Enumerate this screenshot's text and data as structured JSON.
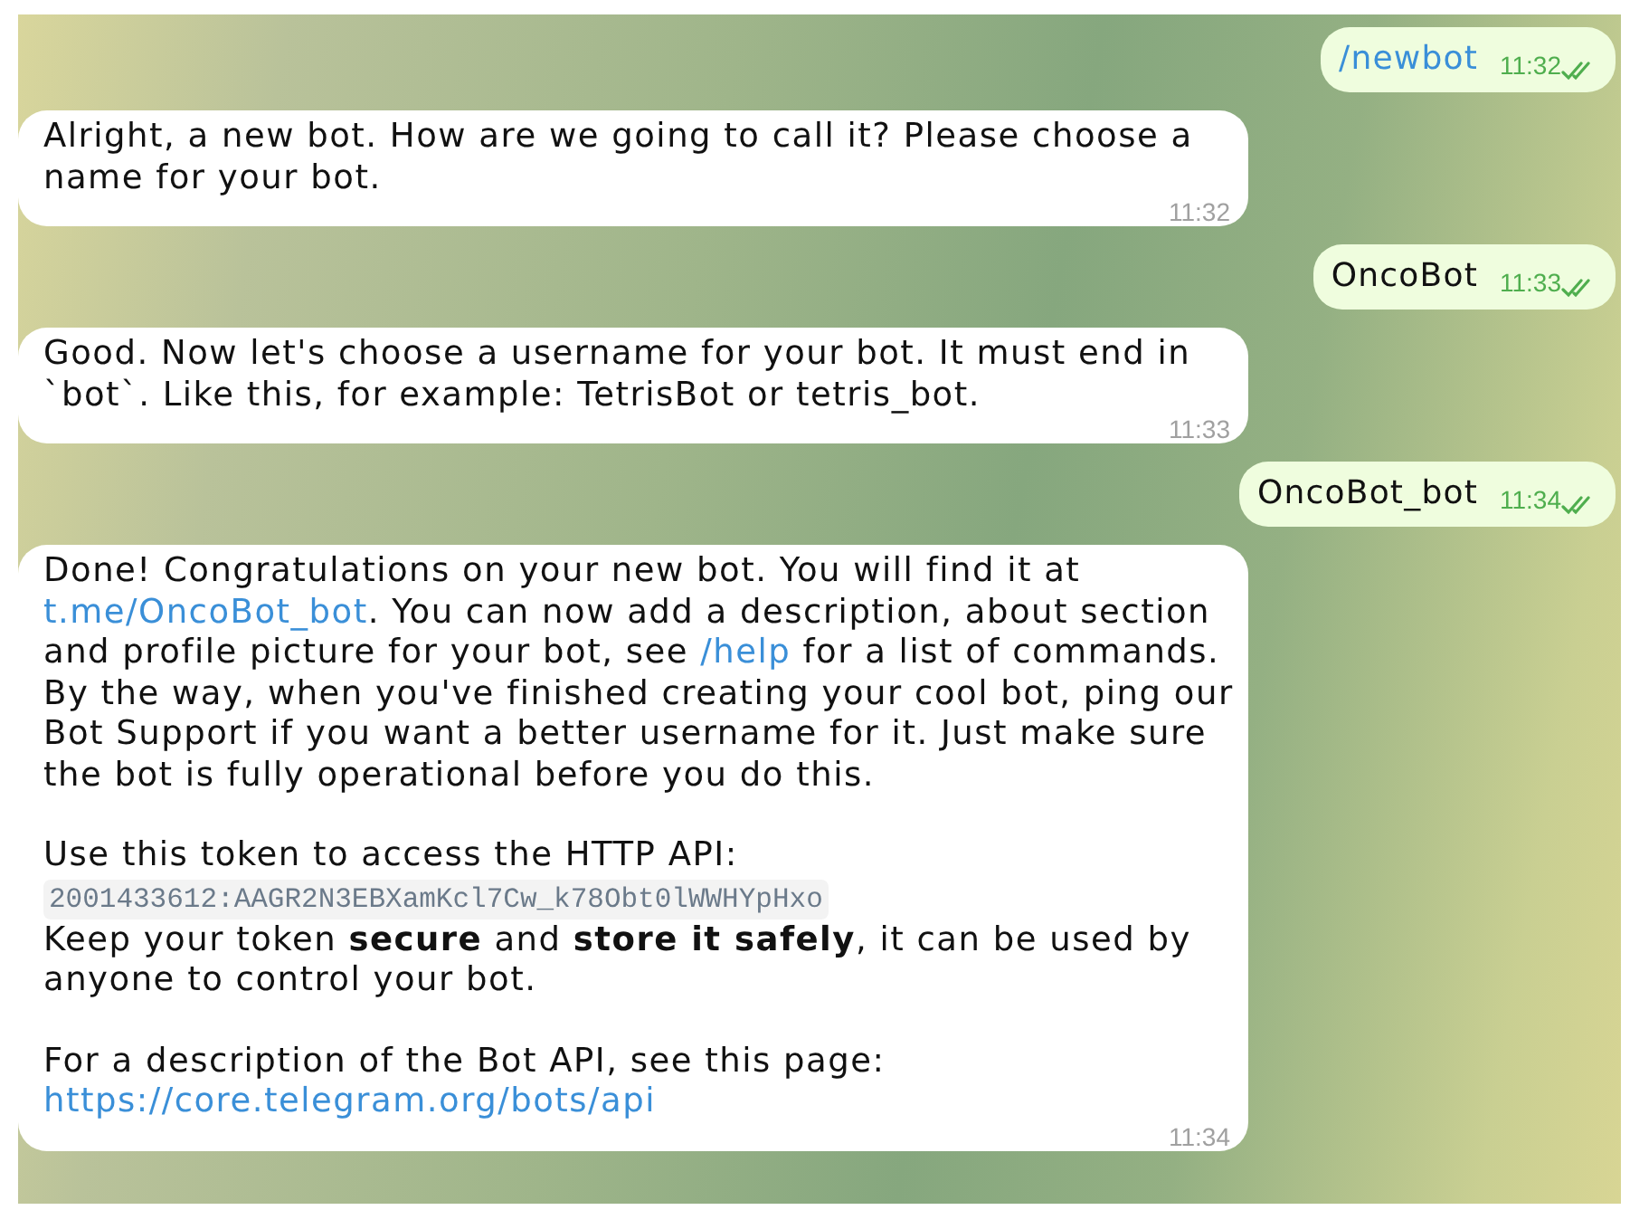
{
  "messages": [
    {
      "kind": "sent",
      "paragraphs": [
        [
          {
            "kind": "text",
            "spans": [
              {
                "kind": "command",
                "text": "/newbot"
              }
            ]
          }
        ]
      ],
      "time": "11:32",
      "read": true
    },
    {
      "kind": "received",
      "paragraphs": [
        [
          {
            "kind": "text",
            "spans": [
              {
                "kind": "plain",
                "text": "Alright, a new bot. How are we going to call it? Please choose a name for your bot."
              }
            ]
          }
        ]
      ],
      "time": "11:32"
    },
    {
      "kind": "sent",
      "paragraphs": [
        [
          {
            "kind": "text",
            "spans": [
              {
                "kind": "plain",
                "text": "OncoBot"
              }
            ]
          }
        ]
      ],
      "time": "11:33",
      "read": true
    },
    {
      "kind": "received",
      "paragraphs": [
        [
          {
            "kind": "text",
            "spans": [
              {
                "kind": "plain",
                "text": "Good. Now let's choose a username for your bot. It must end in `bot`. Like this, for example: TetrisBot or tetris_bot."
              }
            ]
          }
        ]
      ],
      "time": "11:33"
    },
    {
      "kind": "sent",
      "paragraphs": [
        [
          {
            "kind": "text",
            "spans": [
              {
                "kind": "plain",
                "text": "OncoBot_bot"
              }
            ]
          }
        ]
      ],
      "time": "11:34",
      "read": true
    },
    {
      "kind": "received",
      "paragraphs": [
        [
          {
            "kind": "text",
            "spans": [
              {
                "kind": "plain",
                "text": "Done! Congratulations on your new bot. You will find it at "
              },
              {
                "kind": "link",
                "text": "t.me/OncoBot_bot"
              },
              {
                "kind": "plain",
                "text": ". You can now add a description, about section and profile picture for your bot, see "
              },
              {
                "kind": "command",
                "text": "/help"
              },
              {
                "kind": "plain",
                "text": " for a list of commands. By the way, when you've finished creating your cool bot, ping our Bot Support if you want a better username for it. Just make sure the bot is fully operational before you do this."
              }
            ]
          }
        ],
        [
          {
            "kind": "text",
            "spans": [
              {
                "kind": "plain",
                "text": "Use this token to access the HTTP API:"
              }
            ]
          },
          {
            "kind": "code",
            "spans": [
              {
                "kind": "plain",
                "text": "2001433612:AAGR2N3EBXamKcl7Cw_k78Obt0lWWHYpHxo"
              }
            ]
          },
          {
            "kind": "text",
            "spans": [
              {
                "kind": "plain",
                "text": "Keep your token **secure** and **store it safely**, it can be used by anyone to control your bot."
              }
            ]
          }
        ],
        [
          {
            "kind": "text",
            "spans": [
              {
                "kind": "plain",
                "text": "For a description of the Bot API, see this page:"
              }
            ]
          },
          {
            "kind": "text",
            "spans": [
              {
                "kind": "link",
                "text": "https://core.telegram.org/bots/api"
              }
            ]
          }
        ]
      ],
      "time": "11:34"
    }
  ]
}
